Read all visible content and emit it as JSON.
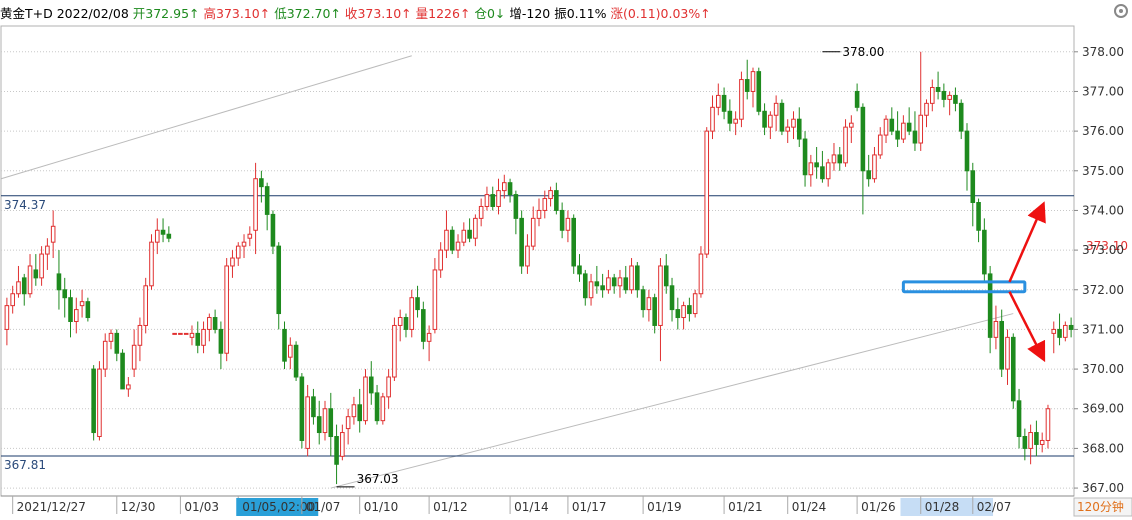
{
  "header": {
    "name": "黄金T+D",
    "date": "2022/02/08",
    "open_label": "开",
    "open": "372.95↑",
    "high_label": "高",
    "high": "373.10↑",
    "low_label": "低",
    "low": "372.70↑",
    "close_label": "收",
    "close": "373.10↑",
    "volume_label": "量",
    "volume": "1226↑",
    "oi_label": "仓",
    "oi": "0↓",
    "increase": "增-120",
    "amplitude": "振0.11%",
    "change": "涨(0.11)0.03%↑"
  },
  "timeframe": "120分钟",
  "colors": {
    "up": "#e03030",
    "down": "#1e8a1e",
    "grid": "#c8c8c8",
    "hline": "#1a3a6a",
    "trend": "#bbbbbb",
    "box": "#2a90e0",
    "arrow": "#ee1111",
    "xhighlight": "#c6ddf5",
    "xhighlight_active": "#2aa0d8"
  },
  "chart_data": {
    "type": "candlestick",
    "ylim": [
      366.8,
      378.6
    ],
    "yticks": [
      "367.00",
      "368.00",
      "369.00",
      "370.00",
      "371.00",
      "372.00",
      "373.00",
      "374.00",
      "375.00",
      "376.00",
      "377.00",
      "378.00"
    ],
    "x_labels": [
      "2021/12/27",
      "12/30",
      "01/03",
      "01/05,02:00",
      "01/07",
      "01/10",
      "01/12",
      "01/14",
      "01/17",
      "01/19",
      "01/21",
      "01/24",
      "01/26",
      "01/28",
      "02/07"
    ],
    "x_label_bars": [
      1,
      19,
      30,
      40,
      51,
      61,
      73,
      87,
      97,
      110,
      124,
      135,
      147,
      158,
      167
    ],
    "x_label_active": 3,
    "x_label_highlight": [
      155,
      170
    ],
    "horizontal_lines": [
      {
        "value": 374.37,
        "label": "374.37"
      },
      {
        "value": 367.81,
        "label": "367.81"
      }
    ],
    "max_marker": {
      "value": 378.0,
      "label": "378.00",
      "bar": 141
    },
    "min_marker": {
      "value": 367.03,
      "label": "367.03",
      "bar": 57
    },
    "last_price": {
      "value": 373.1,
      "label": "373.10"
    },
    "trend_lines": [
      {
        "from": [
          -1,
          374.8
        ],
        "to": [
          70,
          377.9
        ]
      },
      {
        "from": [
          56,
          367.0
        ],
        "to": [
          174,
          371.4
        ]
      }
    ],
    "highlight_box": {
      "from_bar": 155,
      "to_bar": 176,
      "low": 371.95,
      "high": 372.2
    },
    "ohlc": [
      [
        371.0,
        371.8,
        370.6,
        371.6
      ],
      [
        371.6,
        372.1,
        371.4,
        371.9
      ],
      [
        371.9,
        372.6,
        371.8,
        372.2
      ],
      [
        372.3,
        372.4,
        371.6,
        371.9
      ],
      [
        371.9,
        372.9,
        371.8,
        372.6
      ],
      [
        372.5,
        372.9,
        372.1,
        372.3
      ],
      [
        372.3,
        373.1,
        372.1,
        372.9
      ],
      [
        372.9,
        373.3,
        372.5,
        373.1
      ],
      [
        373.2,
        374.0,
        372.8,
        373.6
      ],
      [
        372.4,
        373.0,
        371.5,
        372.0
      ],
      [
        372.0,
        372.3,
        371.3,
        371.8
      ],
      [
        371.8,
        372.0,
        370.8,
        371.2
      ],
      [
        371.2,
        371.8,
        370.9,
        371.5
      ],
      [
        371.6,
        372.0,
        371.3,
        371.7
      ],
      [
        371.7,
        371.8,
        371.2,
        371.3
      ],
      [
        370.0,
        370.1,
        368.2,
        368.4
      ],
      [
        368.3,
        370.2,
        368.2,
        370.0
      ],
      [
        370.0,
        370.9,
        369.8,
        370.7
      ],
      [
        370.7,
        371.0,
        370.5,
        370.9
      ],
      [
        370.9,
        371.0,
        370.2,
        370.4
      ],
      [
        370.4,
        370.5,
        369.5,
        369.5
      ],
      [
        369.5,
        369.8,
        369.3,
        369.6
      ],
      [
        370.0,
        371.0,
        369.8,
        370.6
      ],
      [
        370.6,
        371.3,
        370.2,
        371.1
      ],
      [
        371.1,
        372.3,
        370.9,
        372.1
      ],
      [
        372.1,
        373.4,
        372.0,
        373.2
      ],
      [
        373.2,
        373.8,
        372.9,
        373.5
      ],
      [
        373.5,
        373.8,
        373.2,
        373.4
      ],
      [
        373.4,
        373.6,
        373.2,
        373.3
      ],
      [
        370.9,
        370.9,
        370.9,
        370.9
      ],
      [
        370.9,
        370.9,
        370.9,
        370.9
      ],
      [
        370.9,
        370.9,
        370.9,
        370.9
      ],
      [
        370.8,
        371.1,
        370.6,
        370.9
      ],
      [
        370.9,
        371.2,
        370.4,
        370.6
      ],
      [
        370.6,
        371.2,
        370.4,
        371.0
      ],
      [
        371.0,
        371.4,
        370.7,
        371.3
      ],
      [
        371.3,
        371.5,
        370.9,
        371.0
      ],
      [
        371.0,
        371.2,
        370.0,
        370.4
      ],
      [
        370.4,
        372.8,
        370.2,
        372.6
      ],
      [
        372.6,
        373.0,
        372.3,
        372.8
      ],
      [
        372.8,
        373.2,
        372.6,
        373.1
      ],
      [
        373.1,
        373.4,
        372.8,
        373.2
      ],
      [
        373.3,
        373.6,
        373.1,
        373.4
      ],
      [
        373.5,
        375.2,
        372.9,
        374.8
      ],
      [
        374.8,
        375.0,
        374.2,
        374.6
      ],
      [
        374.6,
        374.7,
        373.5,
        373.9
      ],
      [
        373.9,
        374.0,
        372.9,
        373.1
      ],
      [
        373.1,
        373.2,
        371.0,
        371.4
      ],
      [
        371.0,
        371.2,
        370.0,
        370.2
      ],
      [
        370.3,
        370.8,
        370.0,
        370.6
      ],
      [
        370.6,
        370.7,
        369.7,
        369.8
      ],
      [
        369.8,
        369.9,
        368.0,
        368.2
      ],
      [
        368.0,
        369.6,
        367.8,
        369.3
      ],
      [
        369.3,
        369.5,
        368.6,
        368.8
      ],
      [
        368.8,
        369.2,
        368.1,
        368.4
      ],
      [
        368.4,
        369.2,
        368.2,
        369.0
      ],
      [
        369.0,
        369.4,
        367.8,
        368.3
      ],
      [
        368.3,
        368.6,
        367.1,
        367.6
      ],
      [
        367.8,
        368.6,
        367.7,
        368.4
      ],
      [
        368.5,
        369.0,
        368.1,
        368.8
      ],
      [
        368.8,
        369.3,
        368.6,
        369.1
      ],
      [
        369.1,
        369.5,
        368.4,
        368.7
      ],
      [
        368.7,
        370.0,
        368.6,
        369.8
      ],
      [
        369.8,
        370.2,
        369.1,
        369.4
      ],
      [
        369.4,
        369.6,
        368.6,
        368.7
      ],
      [
        368.7,
        369.4,
        368.6,
        369.3
      ],
      [
        369.3,
        370.0,
        369.0,
        369.8
      ],
      [
        369.8,
        371.3,
        369.7,
        371.1
      ],
      [
        371.1,
        371.5,
        370.7,
        371.3
      ],
      [
        371.3,
        371.4,
        370.8,
        371.0
      ],
      [
        371.0,
        372.0,
        370.8,
        371.8
      ],
      [
        371.8,
        372.1,
        371.3,
        371.5
      ],
      [
        371.5,
        371.7,
        370.5,
        370.7
      ],
      [
        370.7,
        371.1,
        370.2,
        370.9
      ],
      [
        371.0,
        372.8,
        370.9,
        372.5
      ],
      [
        372.5,
        373.2,
        372.3,
        373.0
      ],
      [
        373.0,
        374.0,
        372.8,
        373.5
      ],
      [
        373.5,
        373.6,
        372.9,
        373.0
      ],
      [
        373.0,
        373.4,
        372.8,
        373.2
      ],
      [
        373.2,
        373.7,
        373.1,
        373.5
      ],
      [
        373.5,
        373.8,
        373.2,
        373.3
      ],
      [
        373.3,
        373.9,
        373.1,
        373.8
      ],
      [
        373.8,
        374.3,
        373.6,
        374.1
      ],
      [
        374.1,
        374.6,
        374.0,
        374.4
      ],
      [
        374.4,
        374.6,
        374.0,
        374.1
      ],
      [
        374.1,
        374.8,
        373.9,
        374.5
      ],
      [
        374.5,
        374.9,
        374.3,
        374.7
      ],
      [
        374.7,
        374.8,
        374.2,
        374.4
      ],
      [
        374.4,
        374.5,
        373.4,
        373.8
      ],
      [
        373.8,
        374.0,
        372.4,
        372.6
      ],
      [
        372.6,
        373.4,
        372.4,
        373.1
      ],
      [
        373.1,
        374.1,
        373.0,
        373.8
      ],
      [
        373.8,
        374.3,
        373.6,
        374.0
      ],
      [
        374.0,
        374.5,
        373.8,
        374.3
      ],
      [
        374.3,
        374.6,
        374.1,
        374.5
      ],
      [
        374.5,
        374.7,
        373.9,
        374.0
      ],
      [
        374.0,
        374.2,
        373.3,
        373.5
      ],
      [
        373.5,
        374.0,
        373.2,
        373.8
      ],
      [
        373.8,
        373.9,
        372.4,
        372.6
      ],
      [
        372.6,
        372.9,
        372.2,
        372.4
      ],
      [
        372.4,
        372.5,
        371.6,
        371.8
      ],
      [
        371.8,
        372.4,
        371.6,
        372.2
      ],
      [
        372.2,
        372.6,
        371.9,
        372.1
      ],
      [
        372.1,
        372.4,
        371.8,
        372.0
      ],
      [
        372.0,
        372.5,
        371.9,
        372.3
      ],
      [
        372.3,
        372.4,
        371.9,
        372.1
      ],
      [
        372.1,
        372.5,
        371.8,
        372.3
      ],
      [
        372.3,
        372.6,
        371.9,
        372.0
      ],
      [
        372.0,
        372.8,
        371.9,
        372.6
      ],
      [
        372.6,
        372.7,
        371.8,
        372.0
      ],
      [
        372.0,
        372.1,
        371.3,
        371.5
      ],
      [
        371.5,
        372.0,
        371.2,
        371.8
      ],
      [
        371.8,
        371.9,
        370.9,
        371.1
      ],
      [
        371.1,
        372.8,
        370.2,
        372.6
      ],
      [
        372.6,
        372.9,
        371.9,
        372.1
      ],
      [
        372.1,
        372.3,
        371.2,
        371.5
      ],
      [
        371.5,
        371.8,
        371.0,
        371.3
      ],
      [
        371.3,
        371.7,
        371.0,
        371.6
      ],
      [
        371.6,
        371.8,
        371.2,
        371.4
      ],
      [
        371.4,
        372.0,
        371.3,
        371.9
      ],
      [
        371.9,
        373.1,
        371.8,
        372.9
      ],
      [
        372.9,
        376.1,
        372.8,
        376.0
      ],
      [
        376.0,
        376.9,
        375.8,
        376.6
      ],
      [
        376.6,
        377.2,
        376.4,
        376.9
      ],
      [
        376.9,
        377.1,
        376.3,
        376.5
      ],
      [
        376.5,
        376.8,
        376.0,
        376.2
      ],
      [
        376.2,
        376.5,
        375.9,
        376.3
      ],
      [
        376.3,
        377.5,
        376.1,
        377.3
      ],
      [
        377.3,
        377.8,
        376.8,
        377.0
      ],
      [
        377.0,
        377.6,
        376.6,
        377.5
      ],
      [
        377.5,
        377.6,
        376.4,
        376.5
      ],
      [
        376.5,
        376.7,
        375.9,
        376.1
      ],
      [
        376.1,
        376.5,
        375.8,
        376.4
      ],
      [
        376.4,
        376.9,
        376.0,
        376.7
      ],
      [
        376.7,
        376.8,
        375.9,
        376.0
      ],
      [
        376.0,
        376.3,
        375.7,
        376.1
      ],
      [
        376.1,
        376.5,
        375.8,
        376.3
      ],
      [
        376.3,
        376.6,
        375.6,
        375.8
      ],
      [
        375.8,
        376.0,
        374.6,
        374.9
      ],
      [
        374.9,
        375.4,
        374.6,
        375.2
      ],
      [
        375.2,
        375.6,
        374.8,
        375.1
      ],
      [
        375.1,
        375.5,
        374.7,
        374.8
      ],
      [
        374.8,
        375.3,
        374.6,
        375.2
      ],
      [
        375.2,
        375.7,
        375.0,
        375.4
      ],
      [
        375.4,
        375.6,
        375.0,
        375.2
      ],
      [
        375.2,
        376.3,
        375.1,
        376.1
      ],
      [
        376.1,
        376.4,
        375.7,
        376.2
      ],
      [
        377.0,
        377.2,
        376.5,
        376.6
      ],
      [
        376.6,
        376.7,
        373.9,
        375.0
      ],
      [
        375.0,
        375.4,
        374.6,
        374.8
      ],
      [
        374.8,
        375.6,
        374.7,
        375.4
      ],
      [
        375.4,
        376.1,
        375.3,
        375.9
      ],
      [
        375.9,
        376.4,
        375.7,
        376.3
      ],
      [
        376.3,
        376.6,
        375.9,
        376.0
      ],
      [
        376.0,
        376.5,
        375.6,
        375.8
      ],
      [
        375.8,
        376.4,
        375.7,
        376.2
      ],
      [
        376.2,
        376.6,
        375.9,
        376.0
      ],
      [
        376.0,
        376.5,
        375.5,
        375.7
      ],
      [
        375.7,
        378.0,
        375.5,
        376.4
      ],
      [
        376.4,
        376.8,
        376.1,
        376.7
      ],
      [
        376.7,
        377.3,
        376.5,
        377.1
      ],
      [
        377.1,
        377.5,
        376.8,
        377.0
      ],
      [
        377.0,
        377.2,
        376.6,
        376.8
      ],
      [
        376.8,
        377.0,
        376.4,
        376.9
      ],
      [
        376.9,
        377.1,
        376.5,
        376.7
      ],
      [
        376.7,
        376.8,
        375.8,
        376.0
      ],
      [
        376.0,
        376.2,
        374.5,
        375.0
      ],
      [
        375.0,
        375.2,
        373.6,
        374.2
      ],
      [
        374.2,
        374.3,
        373.2,
        373.5
      ],
      [
        373.5,
        373.8,
        372.2,
        372.4
      ],
      [
        372.4,
        372.6,
        370.4,
        370.8
      ],
      [
        370.8,
        371.6,
        370.5,
        371.2
      ],
      [
        371.2,
        371.5,
        369.8,
        370.0
      ],
      [
        370.0,
        371.0,
        369.6,
        370.8
      ],
      [
        370.8,
        370.9,
        369.0,
        369.2
      ],
      [
        369.2,
        369.5,
        368.0,
        368.3
      ],
      [
        368.3,
        368.5,
        367.7,
        368.0
      ],
      [
        368.0,
        368.6,
        367.6,
        368.4
      ],
      [
        368.4,
        368.7,
        367.8,
        368.1
      ],
      [
        368.1,
        368.4,
        367.9,
        368.2
      ],
      [
        368.2,
        369.1,
        368.0,
        369.0
      ],
      [
        370.9,
        371.2,
        370.4,
        371.0
      ],
      [
        371.0,
        371.4,
        370.6,
        370.8
      ],
      [
        370.8,
        371.2,
        370.7,
        371.1
      ],
      [
        371.1,
        371.3,
        370.8,
        371.0
      ]
    ]
  }
}
